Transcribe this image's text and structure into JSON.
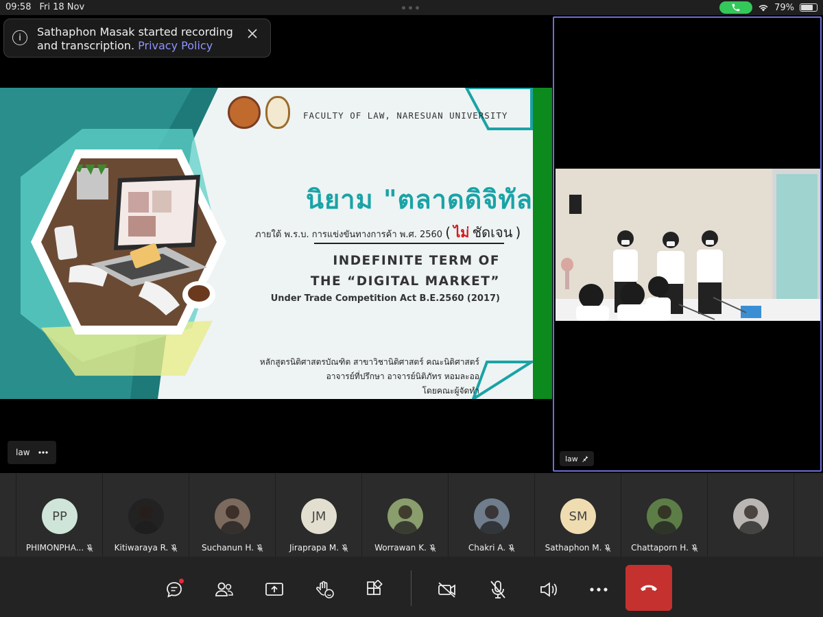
{
  "status_bar": {
    "time": "09:58",
    "date": "Fri 18 Nov",
    "battery": "79%"
  },
  "notification": {
    "text": "Sathaphon Masak started recording and transcription.",
    "link": "Privacy Policy"
  },
  "shared_screen": {
    "faculty": "FACULTY OF LAW, NARESUAN UNIVERSITY",
    "title_thai": "นิยาม \"ตลาดดิจิทัล\"",
    "subtitle_thai": "ภายใต้ พ.ร.บ. การแข่งขันทางการค้า พ.ศ. 2560",
    "subtitle_paren_open": "(",
    "subtitle_highlight": "ไม่",
    "subtitle_rest": "ชัดเจน",
    "subtitle_paren_close": ")",
    "title_en_line1": "INDEFINITE TERM OF",
    "title_en_line2": "THE “DIGITAL MARKET”",
    "title_en_line3": "Under Trade Competition Act B.E.2560 (2017)",
    "credit_line1": "หลักสูตรนิติศาสตรบัณฑิต สาขาวิชานิติศาสตร์ คณะนิติศาสตร์",
    "credit_line2": "อาจารย์ที่ปรึกษา อาจารย์นิติภัทร หอมละออ",
    "credit_line3": "โดยคณะผู้จัดทำ",
    "presenter_label": "law"
  },
  "video_tile": {
    "label": "law"
  },
  "participants": [
    {
      "initials": "PP",
      "name": "PHIMONPHA...",
      "bg": "#cfe5d9"
    },
    {
      "initials": "",
      "name": "Kitiwaraya R.",
      "bg": "#222222"
    },
    {
      "initials": "",
      "name": "Suchanun H.",
      "bg": "#7c6a5e"
    },
    {
      "initials": "JM",
      "name": "Jiraprapa M.",
      "bg": "#e3dfd0"
    },
    {
      "initials": "",
      "name": "Worrawan K.",
      "bg": "#8a9d6d"
    },
    {
      "initials": "",
      "name": "Chakri A.",
      "bg": "#6f7d8c"
    },
    {
      "initials": "SM",
      "name": "Sathaphon M.",
      "bg": "#efdcb0"
    },
    {
      "initials": "",
      "name": "Chattaporn H.",
      "bg": "#5d7d47"
    },
    {
      "initials": "",
      "name": "",
      "bg": "#b9b6b3"
    }
  ],
  "colors": {
    "accent": "#6d6fd6",
    "leave": "#c4312e",
    "slide_teal": "#1aa3a6"
  }
}
